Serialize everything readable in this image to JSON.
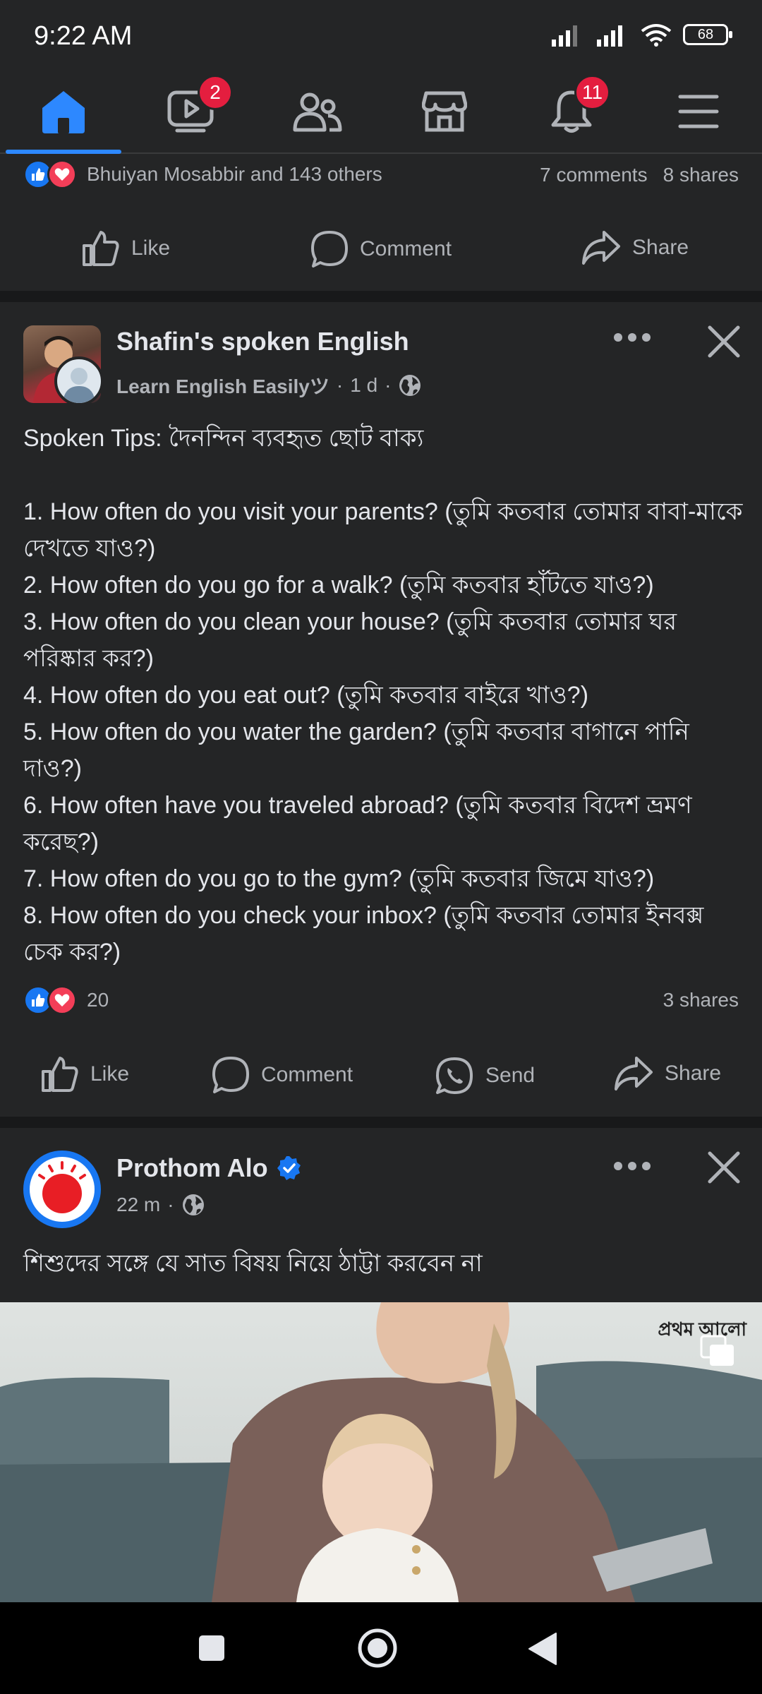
{
  "status_bar": {
    "time": "9:22 AM",
    "battery": "68"
  },
  "top_nav": {
    "items": [
      {
        "name": "home",
        "active": true
      },
      {
        "name": "watch",
        "badge": "2"
      },
      {
        "name": "friends"
      },
      {
        "name": "marketplace"
      },
      {
        "name": "notifications",
        "badge": "11"
      },
      {
        "name": "menu"
      }
    ]
  },
  "prev_post": {
    "reactions_text": "Bhuiyan Mosabbir and 143 others",
    "comments": "7 comments",
    "shares": "8 shares",
    "actions": {
      "like": "Like",
      "comment": "Comment",
      "share": "Share"
    }
  },
  "post1": {
    "author": "Shafin's spoken English",
    "subtitle": "Learn English Easilyツ",
    "time": "1 d",
    "body": "Spoken Tips: দৈনন্দিন ব্যবহৃত ছোট বাক্য\n\n1. How often do you visit your parents? (তুমি কতবার তোমার বাবা-মাকে দেখতে যাও?)\n2. How often do you go for a walk? (তুমি কতবার হাঁটতে যাও?)\n3. How often do you clean your house? (তুমি কতবার তোমার ঘর পরিষ্কার কর?)\n4. How often do you eat out? (তুমি কতবার বাইরে খাও?)\n5. How often do you water the garden? (তুমি কতবার বাগানে পানি দাও?)\n6. How often have you traveled abroad? (তুমি কতবার বিদেশ ভ্রমণ করেছ?)\n7. How often do you go to the gym? (তুমি কতবার জিমে যাও?)\n8. How often do you check your inbox? (তুমি কতবার তোমার ইনবক্স চেক কর?)",
    "reaction_count": "20",
    "shares": "3 shares",
    "actions": {
      "like": "Like",
      "comment": "Comment",
      "send": "Send",
      "share": "Share"
    }
  },
  "post2": {
    "author": "Prothom Alo",
    "time": "22 m",
    "text": "শিশুদের সঙ্গে যে সাত বিষয় নিয়ে ঠাট্টা করবেন না",
    "image_watermark": "প্রথম আলো"
  },
  "colors": {
    "accent": "#2d88ff",
    "badge": "#e41e3f",
    "like": "#1877f2",
    "love": "#f33e58"
  }
}
